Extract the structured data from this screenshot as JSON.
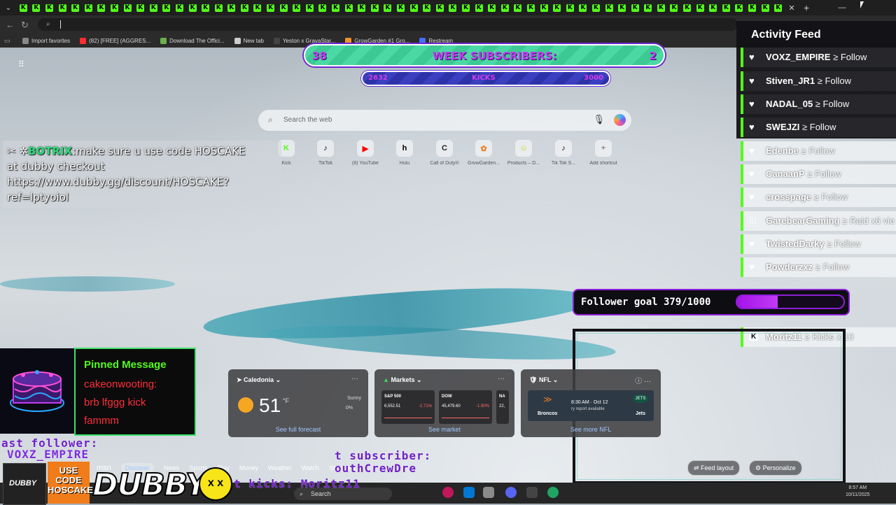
{
  "browser": {
    "tab_letter": "K",
    "tab_count": 59,
    "favorites": [
      {
        "label": "Import favorites",
        "color": "#888888"
      },
      {
        "label": "(82) [FREE] (AGGRES...",
        "color": "#ff2d2d"
      },
      {
        "label": "Download The Offici...",
        "color": "#6ab04c"
      },
      {
        "label": "New tab",
        "color": "#cccccc"
      },
      {
        "label": "Yeston x GravaStar...",
        "color": "#444444"
      },
      {
        "label": "GrowGarden #1 Gro...",
        "color": "#f0932b"
      },
      {
        "label": "Restream",
        "color": "#4a6cf7"
      }
    ]
  },
  "stream": {
    "week_subs_left": "38",
    "week_subs_label": "WEEK SUBSCRIBERS:",
    "week_subs_right": "2",
    "kicks_left": "2632",
    "kicks_label": "KICKS",
    "kicks_right": "3000",
    "botrix_name": "BOTRIX",
    "botrix_lines": [
      "make sure u use code HOSCAKE",
      "at dubby checkout",
      "https://www.dubby.gg/discount/HOSCAKE?",
      "ref=lptyoiol"
    ],
    "follower_goal_label": "Follower goal 379/1000",
    "follower_goal_progress": 0.379,
    "pinned_title": "Pinned Message",
    "pinned_lines": [
      "cakeonwooting:",
      "brb lfggg kick",
      "fammm"
    ],
    "last_follower": "ast follower:",
    "last_follower_name": "VOXZ_EMPIRE",
    "last_subscriber": "t subscriber:",
    "last_subscriber_name": "outhCrewDre",
    "last_kicks": "t kicks: Moritz11",
    "use_code": [
      "USE",
      "CODE",
      "HOSCAKE"
    ],
    "dubby_logo": "DUBBY",
    "dubby_thumb": "DUBBY"
  },
  "activity_feed": {
    "title": "Activity Feed",
    "items": [
      {
        "name": "VOXZ_EMPIRE",
        "action": "Follow",
        "icon": "heart-icon",
        "dark": true
      },
      {
        "name": "Stiven_JR1",
        "action": "Follow",
        "icon": "heart-icon",
        "dark": true
      },
      {
        "name": "NADAL_05",
        "action": "Follow",
        "icon": "heart-icon",
        "dark": true
      },
      {
        "name": "SWEJZI",
        "action": "Follow",
        "icon": "heart-icon",
        "dark": true
      },
      {
        "name": "Edenbe",
        "action": "Follow",
        "icon": "heart-icon",
        "dark": false
      },
      {
        "name": "CanaanP",
        "action": "Follow",
        "icon": "heart-icon",
        "dark": false
      },
      {
        "name": "crosspage",
        "action": "Follow",
        "icon": "heart-icon",
        "dark": false
      },
      {
        "name": "GarebearGaming",
        "action": "Raid x6 vie",
        "icon": "raid-icon",
        "dark": false
      },
      {
        "name": "TwistedDarky",
        "action": "Follow",
        "icon": "heart-icon",
        "dark": false
      },
      {
        "name": "Powderzxz",
        "action": "Follow",
        "icon": "heart-icon",
        "dark": false
      },
      {
        "name": "Moritz11",
        "action": "Kicks x 10",
        "icon": "kick-icon",
        "dark": false
      }
    ]
  },
  "newtab": {
    "search_placeholder": "Search the web",
    "shortcuts": [
      {
        "label": "Kick",
        "glyph": "K"
      },
      {
        "label": "TikTok",
        "glyph": "♪"
      },
      {
        "label": "(6) YouTube",
        "glyph": "▶"
      },
      {
        "label": "Hulu",
        "glyph": "h"
      },
      {
        "label": "Call of Duty®",
        "glyph": "C"
      },
      {
        "label": "GrowGarden...",
        "glyph": "✿"
      },
      {
        "label": "Products – D...",
        "glyph": "☺"
      },
      {
        "label": "Tik Tok S...",
        "glyph": "♪"
      },
      {
        "label": "Add shortcut",
        "glyph": "+"
      }
    ],
    "weather": {
      "location": "Caledonia",
      "temp": "51",
      "unit": "°F",
      "condition": "Sunny",
      "precip": "0%",
      "link": "See full forecast"
    },
    "markets": {
      "title": "Markets",
      "items": [
        {
          "name": "S&P 500",
          "value": "6,552.51",
          "change": "-2.71%"
        },
        {
          "name": "DOW",
          "value": "45,479.60",
          "change": "-1.90%"
        },
        {
          "name": "NA",
          "value": "22,",
          "change": ""
        }
      ],
      "link": "See market"
    },
    "nfl": {
      "title": "NFL",
      "team_a": "Broncos",
      "team_b": "Jets",
      "time": "8:30 AM · Oct 12",
      "note": "ry report available",
      "link": "See more NFL"
    },
    "msn_tabs": [
      "msn",
      "Discover",
      "News",
      "Sports",
      "Play",
      "Money",
      "Weather",
      "Watch",
      "Shopping"
    ],
    "feed_layout": "Feed layout",
    "personalize": "Personalize"
  },
  "taskbar": {
    "search": "Search",
    "time": "8:57 AM",
    "date": "10/11/2025"
  }
}
